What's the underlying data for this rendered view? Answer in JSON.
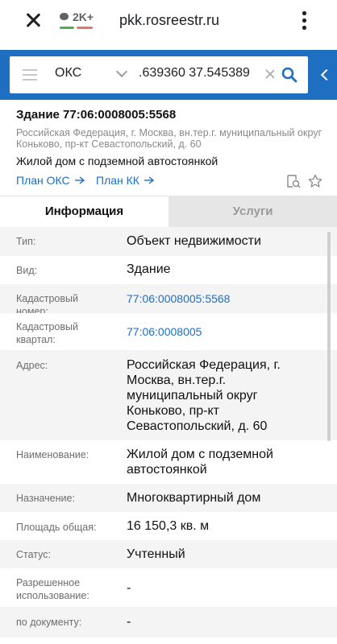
{
  "browser": {
    "tab_count": "2K+",
    "url": "pkk.rosreestr.ru"
  },
  "search": {
    "layer": "ОКС",
    "query": ".639360 37.545389"
  },
  "object": {
    "title": "Здание 77:06:0008005:5568",
    "address": "Российская Федерация, г. Москва, вн.тер.г. муниципальный округ Коньково, пр-кт Севастопольский, д. 60",
    "name": "Жилой дом с подземной автостоянкой",
    "plan_oks": "План ОКС",
    "plan_kk": "План КК"
  },
  "tabs": {
    "info": "Информация",
    "services": "Услуги"
  },
  "rows": [
    {
      "label": "Тип:",
      "value": "Объект недвижимости"
    },
    {
      "label": "Вид:",
      "value": "Здание"
    },
    {
      "label": "Кадастровый номер:",
      "value": "77:06:0008005:5568"
    },
    {
      "label": "Кадастровый квартал:",
      "value": "77:06:0008005"
    },
    {
      "label": "Адрес:",
      "value": "Российская Федерация, г. Москва, вн.тер.г. муниципальный округ Коньково, пр-кт Севастопольский, д. 60"
    },
    {
      "label": "Наименование:",
      "value": "Жилой дом с подземной автостоянкой"
    },
    {
      "label": "Назначение:",
      "value": "Многоквартирный дом"
    },
    {
      "label": "Площадь общая:",
      "value": "16 150,3 кв. м"
    },
    {
      "label": "Статус:",
      "value": "Учтенный"
    },
    {
      "label": "Разрешенное использование:",
      "value": "-"
    },
    {
      "label": "по документу:",
      "value": "-"
    }
  ],
  "colors": {
    "accent": "#1e6ec1",
    "tab_inactive_bg": "#e6e6e6"
  }
}
